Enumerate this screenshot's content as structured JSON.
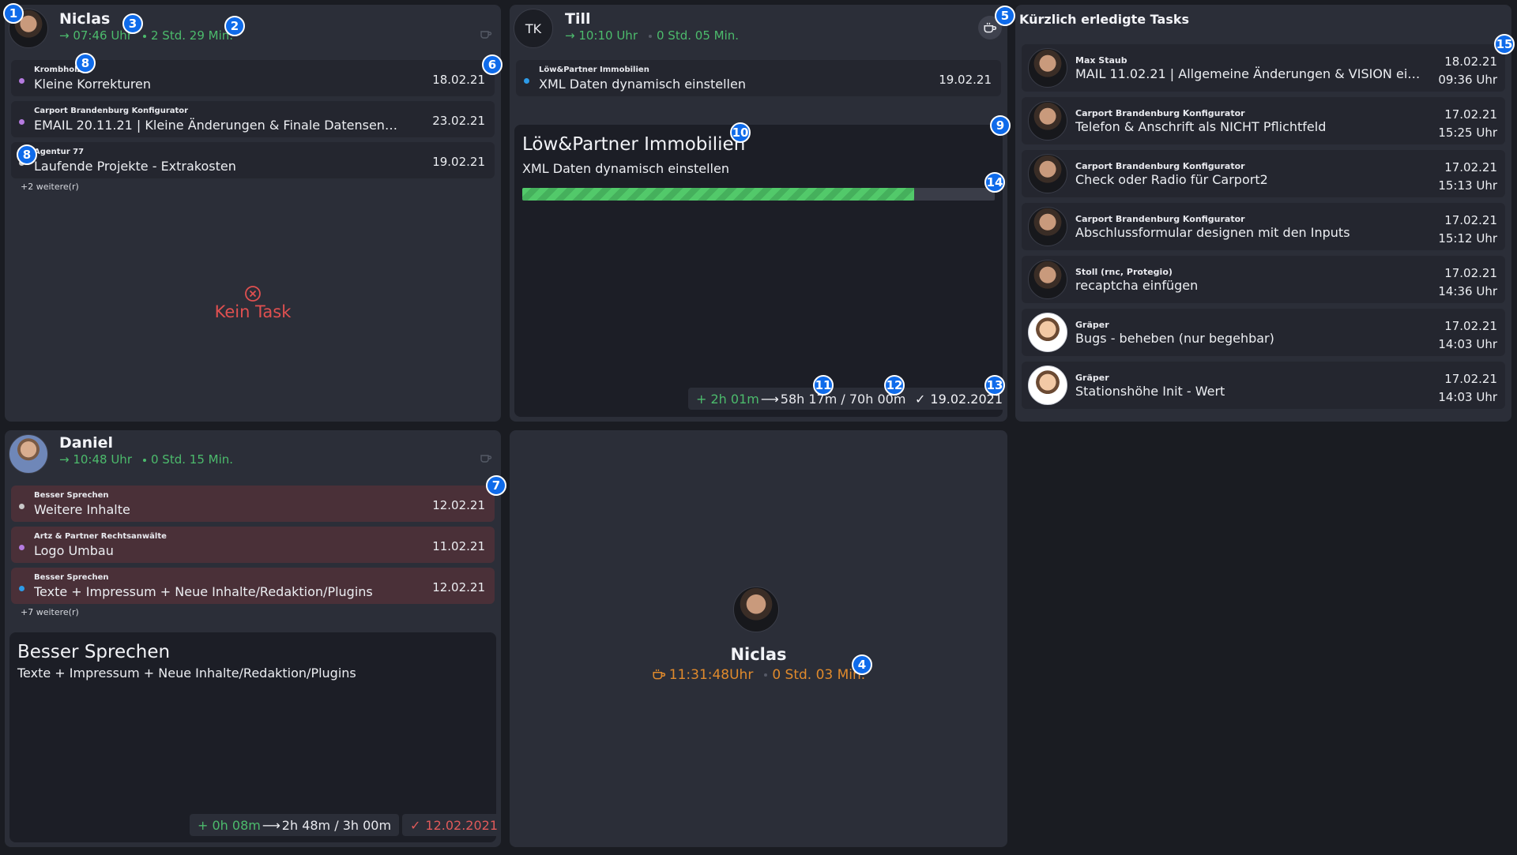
{
  "niclas_card": {
    "name": "Niclas",
    "start_time": "→ 07:46 Uhr",
    "duration": "2 Std. 29 Min.",
    "tasks": [
      {
        "client": "Krombholz",
        "title": "Kleine Korrekturen",
        "date": "18.02.21",
        "dot": "#b57be0"
      },
      {
        "client": "Carport Brandenburg Konfigurator",
        "title": "EMAIL 20.11.21 | Kleine Änderungen & Finale Datensendu...",
        "date": "23.02.21",
        "dot": "#b57be0"
      },
      {
        "client": "Agentur 77",
        "title": "Laufende Projekte - Extrakosten",
        "date": "19.02.21",
        "dot": "#c8c8c8"
      }
    ],
    "more": "+2 weitere(r)",
    "no_task": "Kein Task",
    "no_task_icon": "x-circle-icon"
  },
  "till_card": {
    "initials": "TK",
    "name": "Till",
    "start_time": "→ 10:10 Uhr",
    "duration": "0 Std. 05 Min.",
    "coffee_icon": "coffee-icon",
    "tasks": [
      {
        "client": "Löw&Partner Immobilien",
        "title": "XML Daten dynamisch einstellen",
        "date": "19.02.21",
        "dot": "#2d9be8"
      }
    ],
    "current": {
      "client": "Löw&Partner Immobilien",
      "title": "XML Daten dynamisch einstellen",
      "progress": 0.83,
      "time_added": "+ 2h 01m",
      "time_total": "58h 17m / 70h 00m",
      "due": "19.02.2021"
    }
  },
  "daniel_card": {
    "name": "Daniel",
    "start_time": "→ 10:48 Uhr",
    "duration": "0 Std. 15 Min.",
    "tasks": [
      {
        "client": "Besser Sprechen",
        "title": "Weitere Inhalte",
        "date": "12.02.21",
        "dot": "#c8c8c8"
      },
      {
        "client": "Artz & Partner Rechtsanwälte",
        "title": "Logo Umbau",
        "date": "11.02.21",
        "dot": "#b57be0"
      },
      {
        "client": "Besser Sprechen",
        "title": "Texte + Impressum + Neue Inhalte/Redaktion/Plugins",
        "date": "12.02.21",
        "dot": "#2d9be8"
      }
    ],
    "more": "+7 weitere(r)",
    "current": {
      "client": "Besser Sprechen",
      "title": "Texte + Impressum + Neue Inhalte/Redaktion/Plugins",
      "time_added": "+ 0h 08m",
      "time_total": "2h 48m / 3h 00m",
      "due": "12.02.2021"
    }
  },
  "break_card": {
    "name": "Niclas",
    "break_time": "11:31:48Uhr",
    "duration": "0 Std. 03 Min."
  },
  "recent": {
    "title": "Kürzlich erledigte Tasks",
    "items": [
      {
        "client": "Max Staub",
        "title": "MAIL 11.02.21 | Allgemeine Änderungen & VISION einfach...",
        "date": "18.02.21",
        "time": "09:36 Uhr",
        "avatar": "photo"
      },
      {
        "client": "Carport Brandenburg Konfigurator",
        "title": "Telefon & Anschrift als NICHT Pflichtfeld",
        "date": "17.02.21",
        "time": "15:25 Uhr",
        "avatar": "photo"
      },
      {
        "client": "Carport Brandenburg Konfigurator",
        "title": "Check oder Radio für Carport2",
        "date": "17.02.21",
        "time": "15:13 Uhr",
        "avatar": "photo"
      },
      {
        "client": "Carport Brandenburg Konfigurator",
        "title": "Abschlussformular designen mit den Inputs",
        "date": "17.02.21",
        "time": "15:12 Uhr",
        "avatar": "photo"
      },
      {
        "client": "Stoll (rnc, Protegio)",
        "title": "recaptcha einfügen",
        "date": "17.02.21",
        "time": "14:36 Uhr",
        "avatar": "photo"
      },
      {
        "client": "Gräper",
        "title": "Bugs - beheben (nur begehbar)",
        "date": "17.02.21",
        "time": "14:03 Uhr",
        "avatar": "cartoon"
      },
      {
        "client": "Gräper",
        "title": "Stationshöhe Init - Wert",
        "date": "17.02.21",
        "time": "14:03 Uhr",
        "avatar": "cartoon"
      }
    ]
  },
  "badges": [
    "1",
    "2",
    "3",
    "4",
    "5",
    "6",
    "7",
    "8",
    "8",
    "9",
    "10",
    "11",
    "12",
    "13",
    "14",
    "15"
  ],
  "colors": {
    "accent_green": "#4cbb6c",
    "break_orange": "#e08a2c",
    "overdue_red": "#e05a5a",
    "badge_blue": "#0f6bea"
  }
}
